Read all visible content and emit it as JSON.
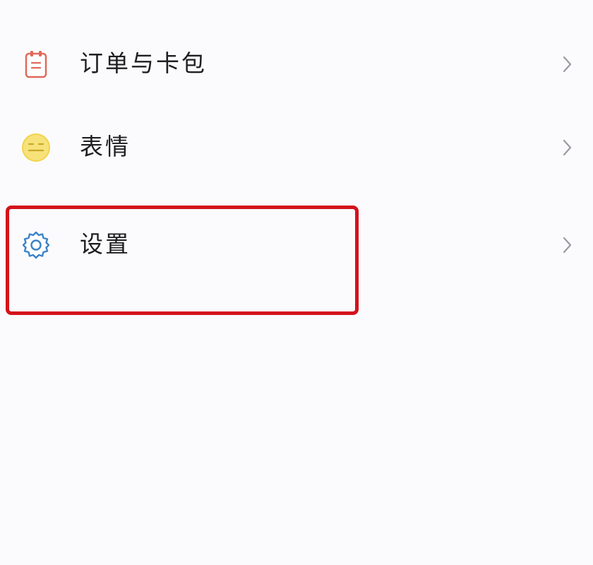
{
  "menu": {
    "items": [
      {
        "label": "订单与卡包",
        "icon": "order-card-icon"
      },
      {
        "label": "表情",
        "icon": "smiley-icon"
      },
      {
        "label": "设置",
        "icon": "gear-icon"
      }
    ]
  },
  "colors": {
    "background": "#fbfbfd",
    "text": "#1f1f22",
    "highlight_border": "#d4121b",
    "order_icon": "#e06a5a",
    "smiley_icon": "#f2d34b",
    "gear_icon": "#3a83c7",
    "chevron": "#9a9aa0"
  },
  "highlight": {
    "target": "settings"
  }
}
